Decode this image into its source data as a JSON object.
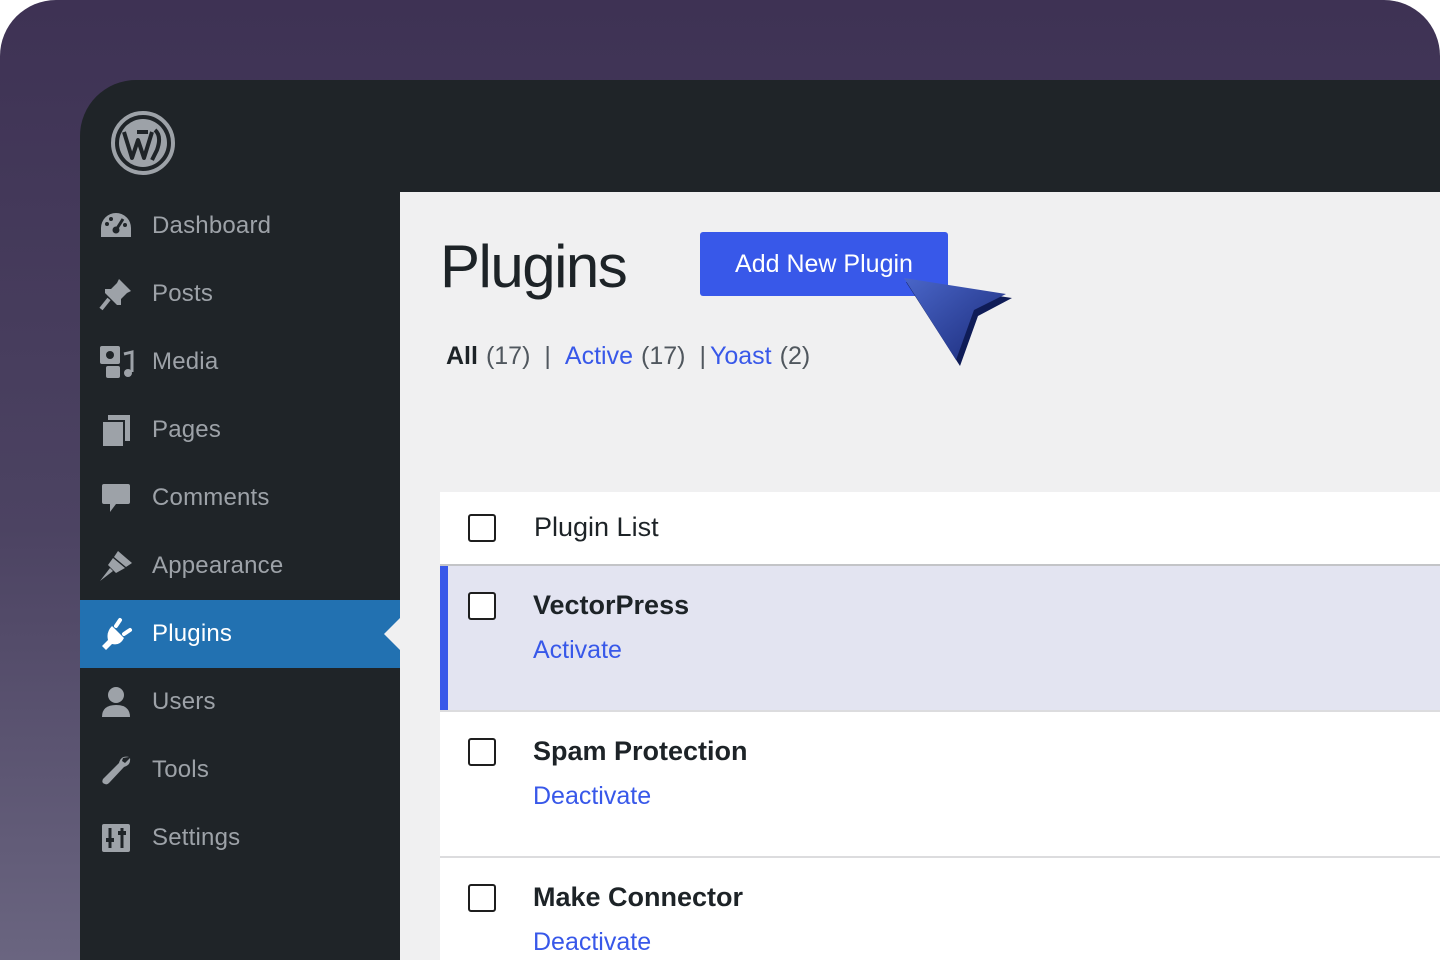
{
  "colors": {
    "sidebar_bg": "#1f2428",
    "sidebar_active": "#2271b1",
    "accent": "#3858e9",
    "content_bg": "#f0f0f1",
    "inactive_row_bg": "#e3e4f1"
  },
  "sidebar": {
    "logo": "wordpress-logo-icon",
    "items": [
      {
        "label": "Dashboard",
        "icon": "dashboard-icon",
        "active": false
      },
      {
        "label": "Posts",
        "icon": "pin-icon",
        "active": false
      },
      {
        "label": "Media",
        "icon": "media-icon",
        "active": false
      },
      {
        "label": "Pages",
        "icon": "pages-icon",
        "active": false
      },
      {
        "label": "Comments",
        "icon": "comment-icon",
        "active": false
      },
      {
        "label": "Appearance",
        "icon": "brush-icon",
        "active": false
      },
      {
        "label": "Plugins",
        "icon": "plug-icon",
        "active": true
      },
      {
        "label": "Users",
        "icon": "user-icon",
        "active": false
      },
      {
        "label": "Tools",
        "icon": "wrench-icon",
        "active": false
      },
      {
        "label": "Settings",
        "icon": "settings-sliders-icon",
        "active": false
      }
    ]
  },
  "main": {
    "title": "Plugins",
    "add_button_label": "Add New Plugin",
    "filters": {
      "all_label": "All",
      "all_count": "(17)",
      "active_label": "Active",
      "active_count": "(17)",
      "yoast_label": "Yoast",
      "yoast_count": "(2)",
      "separator": "|"
    },
    "table": {
      "header_label": "Plugin List",
      "rows": [
        {
          "name": "VectorPress",
          "action": "Activate",
          "state": "inactive"
        },
        {
          "name": "Spam Protection",
          "action": "Deactivate",
          "state": "active"
        },
        {
          "name": "Make Connector",
          "action": "Deactivate",
          "state": "active"
        }
      ]
    }
  }
}
